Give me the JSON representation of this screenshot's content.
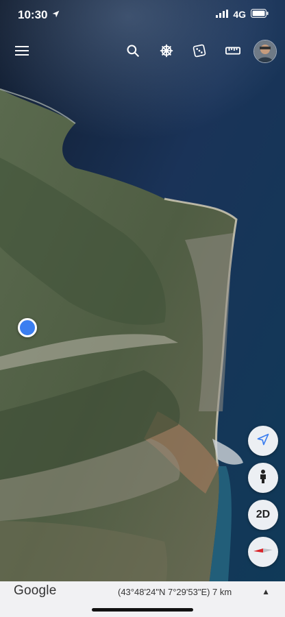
{
  "status": {
    "time": "10:30",
    "network": "4G"
  },
  "toolbar": {
    "menu_icon": "hamburger-menu-icon",
    "search_icon": "search-icon",
    "voyager_icon": "ship-wheel-icon",
    "feeling_lucky_icon": "dice-icon",
    "measure_icon": "ruler-icon"
  },
  "map_controls": {
    "mode_label": "2D"
  },
  "bottom": {
    "brand": "Google",
    "coordinates": "(43°48'24\"N 7°29'53\"E) 7 km",
    "caret": "▲"
  }
}
